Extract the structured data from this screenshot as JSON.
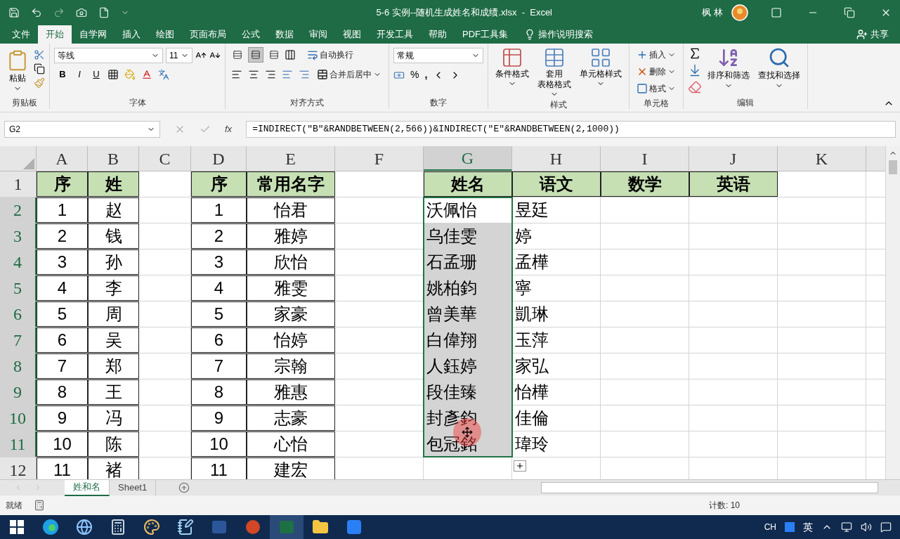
{
  "window": {
    "title": "5-6 实例--随机生成姓名和成绩.xlsx  -  Excel",
    "user": "枫 林"
  },
  "menu_tabs": [
    {
      "label": "文件",
      "selected": false
    },
    {
      "label": "开始",
      "selected": true
    },
    {
      "label": "自学网",
      "selected": false
    },
    {
      "label": "插入",
      "selected": false
    },
    {
      "label": "绘图",
      "selected": false
    },
    {
      "label": "页面布局",
      "selected": false
    },
    {
      "label": "公式",
      "selected": false
    },
    {
      "label": "数据",
      "selected": false
    },
    {
      "label": "审阅",
      "selected": false
    },
    {
      "label": "视图",
      "selected": false
    },
    {
      "label": "开发工具",
      "selected": false
    },
    {
      "label": "帮助",
      "selected": false
    },
    {
      "label": "PDF工具集",
      "selected": false
    }
  ],
  "tell_me": "操作说明搜索",
  "share": "共享",
  "ribbon": {
    "clipboard": {
      "label": "剪贴板",
      "paste": "粘贴"
    },
    "font": {
      "label": "字体",
      "name": "等线",
      "size": "11",
      "styles": [
        "B",
        "I",
        "U"
      ]
    },
    "alignment": {
      "label": "对齐方式",
      "wrap": "自动换行",
      "merge": "合并后居中",
      "valign": [
        {
          "selected": false
        },
        {
          "selected": true
        },
        {
          "selected": false
        }
      ]
    },
    "number": {
      "label": "数字",
      "format": "常规",
      "percent": "%",
      "comma": ","
    },
    "styles": {
      "label": "样式",
      "buttons": [
        [
          "条件格式"
        ],
        [
          "套用",
          "表格格式"
        ],
        [
          "单元格样式"
        ]
      ]
    },
    "cells": {
      "label": "单元格",
      "buttons": [
        "插入",
        "删除",
        "格式"
      ]
    },
    "editing": {
      "label": "编辑",
      "buttons": [
        "排序和筛选",
        "查找和选择"
      ]
    }
  },
  "formula_bar": {
    "name_box": "G2",
    "fx": "fx",
    "formula": "=INDIRECT(\"B\"&RANDBETWEEN(2,566))&INDIRECT(\"E\"&RANDBETWEEN(2,1000))"
  },
  "columns": [
    {
      "label": "A",
      "selected": false
    },
    {
      "label": "B",
      "selected": false
    },
    {
      "label": "C",
      "selected": false
    },
    {
      "label": "D",
      "selected": false
    },
    {
      "label": "E",
      "selected": false
    },
    {
      "label": "F",
      "selected": false
    },
    {
      "label": "G",
      "selected": true
    },
    {
      "label": "H",
      "selected": false
    },
    {
      "label": "I",
      "selected": false
    },
    {
      "label": "J",
      "selected": false
    },
    {
      "label": "K",
      "selected": false
    }
  ],
  "rows": [
    {
      "label": "1",
      "selected": false,
      "cells": [
        {
          "text": "序",
          "kind": "header"
        },
        {
          "text": "姓",
          "kind": "header"
        },
        null,
        {
          "text": "序",
          "kind": "header"
        },
        {
          "text": "常用名字",
          "kind": "header"
        },
        null,
        {
          "text": "姓名",
          "kind": "header"
        },
        {
          "text": "语文",
          "kind": "header"
        },
        {
          "text": "数学",
          "kind": "header"
        },
        {
          "text": "英语",
          "kind": "header"
        },
        null
      ]
    },
    {
      "label": "2",
      "selected": true,
      "cells": [
        {
          "text": "1",
          "kind": "table"
        },
        {
          "text": "赵",
          "kind": "table"
        },
        null,
        {
          "text": "1",
          "kind": "table"
        },
        {
          "text": "怡君",
          "kind": "table"
        },
        null,
        {
          "text": "沃佩怡",
          "kind": "plain"
        },
        {
          "text": "昱廷",
          "kind": "plain"
        },
        null,
        null,
        null
      ]
    },
    {
      "label": "3",
      "selected": true,
      "cells": [
        {
          "text": "2",
          "kind": "table"
        },
        {
          "text": "钱",
          "kind": "table"
        },
        null,
        {
          "text": "2",
          "kind": "table"
        },
        {
          "text": "雅婷",
          "kind": "table"
        },
        null,
        {
          "text": "乌佳雯",
          "kind": "plain"
        },
        {
          "text": "婷",
          "kind": "plain"
        },
        null,
        null,
        null
      ]
    },
    {
      "label": "4",
      "selected": true,
      "cells": [
        {
          "text": "3",
          "kind": "table"
        },
        {
          "text": "孙",
          "kind": "table"
        },
        null,
        {
          "text": "3",
          "kind": "table"
        },
        {
          "text": "欣怡",
          "kind": "table"
        },
        null,
        {
          "text": "石孟珊",
          "kind": "plain"
        },
        {
          "text": "孟樺",
          "kind": "plain"
        },
        null,
        null,
        null
      ]
    },
    {
      "label": "5",
      "selected": true,
      "cells": [
        {
          "text": "4",
          "kind": "table"
        },
        {
          "text": "李",
          "kind": "table"
        },
        null,
        {
          "text": "4",
          "kind": "table"
        },
        {
          "text": "雅雯",
          "kind": "table"
        },
        null,
        {
          "text": "姚柏鈞",
          "kind": "plain"
        },
        {
          "text": "寧",
          "kind": "plain"
        },
        null,
        null,
        null
      ]
    },
    {
      "label": "6",
      "selected": true,
      "cells": [
        {
          "text": "5",
          "kind": "table"
        },
        {
          "text": "周",
          "kind": "table"
        },
        null,
        {
          "text": "5",
          "kind": "table"
        },
        {
          "text": "家豪",
          "kind": "table"
        },
        null,
        {
          "text": "曾美華",
          "kind": "plain"
        },
        {
          "text": "凱琳",
          "kind": "plain"
        },
        null,
        null,
        null
      ]
    },
    {
      "label": "7",
      "selected": true,
      "cells": [
        {
          "text": "6",
          "kind": "table"
        },
        {
          "text": "吴",
          "kind": "table"
        },
        null,
        {
          "text": "6",
          "kind": "table"
        },
        {
          "text": "怡婷",
          "kind": "table"
        },
        null,
        {
          "text": "白偉翔",
          "kind": "plain"
        },
        {
          "text": "玉萍",
          "kind": "plain"
        },
        null,
        null,
        null
      ]
    },
    {
      "label": "8",
      "selected": true,
      "cells": [
        {
          "text": "7",
          "kind": "table"
        },
        {
          "text": "郑",
          "kind": "table"
        },
        null,
        {
          "text": "7",
          "kind": "table"
        },
        {
          "text": "宗翰",
          "kind": "table"
        },
        null,
        {
          "text": "人鈺婷",
          "kind": "plain"
        },
        {
          "text": "家弘",
          "kind": "plain"
        },
        null,
        null,
        null
      ]
    },
    {
      "label": "9",
      "selected": true,
      "cells": [
        {
          "text": "8",
          "kind": "table"
        },
        {
          "text": "王",
          "kind": "table"
        },
        null,
        {
          "text": "8",
          "kind": "table"
        },
        {
          "text": "雅惠",
          "kind": "table"
        },
        null,
        {
          "text": "段佳臻",
          "kind": "plain"
        },
        {
          "text": "怡樺",
          "kind": "plain"
        },
        null,
        null,
        null
      ]
    },
    {
      "label": "10",
      "selected": true,
      "cells": [
        {
          "text": "9",
          "kind": "table"
        },
        {
          "text": "冯",
          "kind": "table"
        },
        null,
        {
          "text": "9",
          "kind": "table"
        },
        {
          "text": "志豪",
          "kind": "table"
        },
        null,
        {
          "text": "封彥鈞",
          "kind": "plain"
        },
        {
          "text": "佳倫",
          "kind": "plain"
        },
        null,
        null,
        null
      ]
    },
    {
      "label": "11",
      "selected": true,
      "cells": [
        {
          "text": "10",
          "kind": "table"
        },
        {
          "text": "陈",
          "kind": "table"
        },
        null,
        {
          "text": "10",
          "kind": "table"
        },
        {
          "text": "心怡",
          "kind": "table"
        },
        null,
        {
          "text": "包冠銘",
          "kind": "plain"
        },
        {
          "text": "瑋玲",
          "kind": "plain"
        },
        null,
        null,
        null
      ]
    },
    {
      "label": "12",
      "selected": false,
      "cells": [
        {
          "text": "11",
          "kind": "table"
        },
        {
          "text": "褚",
          "kind": "table"
        },
        null,
        {
          "text": "11",
          "kind": "table"
        },
        {
          "text": "建宏",
          "kind": "table"
        },
        null,
        null,
        null,
        null,
        null,
        null
      ]
    }
  ],
  "sheet_tabs": [
    {
      "label": "姓和名",
      "selected": true
    },
    {
      "label": "Sheet1",
      "selected": false
    }
  ],
  "status_bar": {
    "mode": "就绪",
    "count": "计数: 10"
  },
  "taskbar": {
    "apps": [
      {
        "selected": false
      },
      {
        "selected": false
      },
      {
        "selected": false
      },
      {
        "selected": false
      },
      {
        "selected": false
      },
      {
        "selected": false
      },
      {
        "selected": false
      },
      {
        "selected": false
      },
      {
        "selected": true
      },
      {
        "selected": false
      },
      {
        "selected": false
      }
    ],
    "tray": {
      "lang": "CH",
      "ime": "英"
    }
  }
}
